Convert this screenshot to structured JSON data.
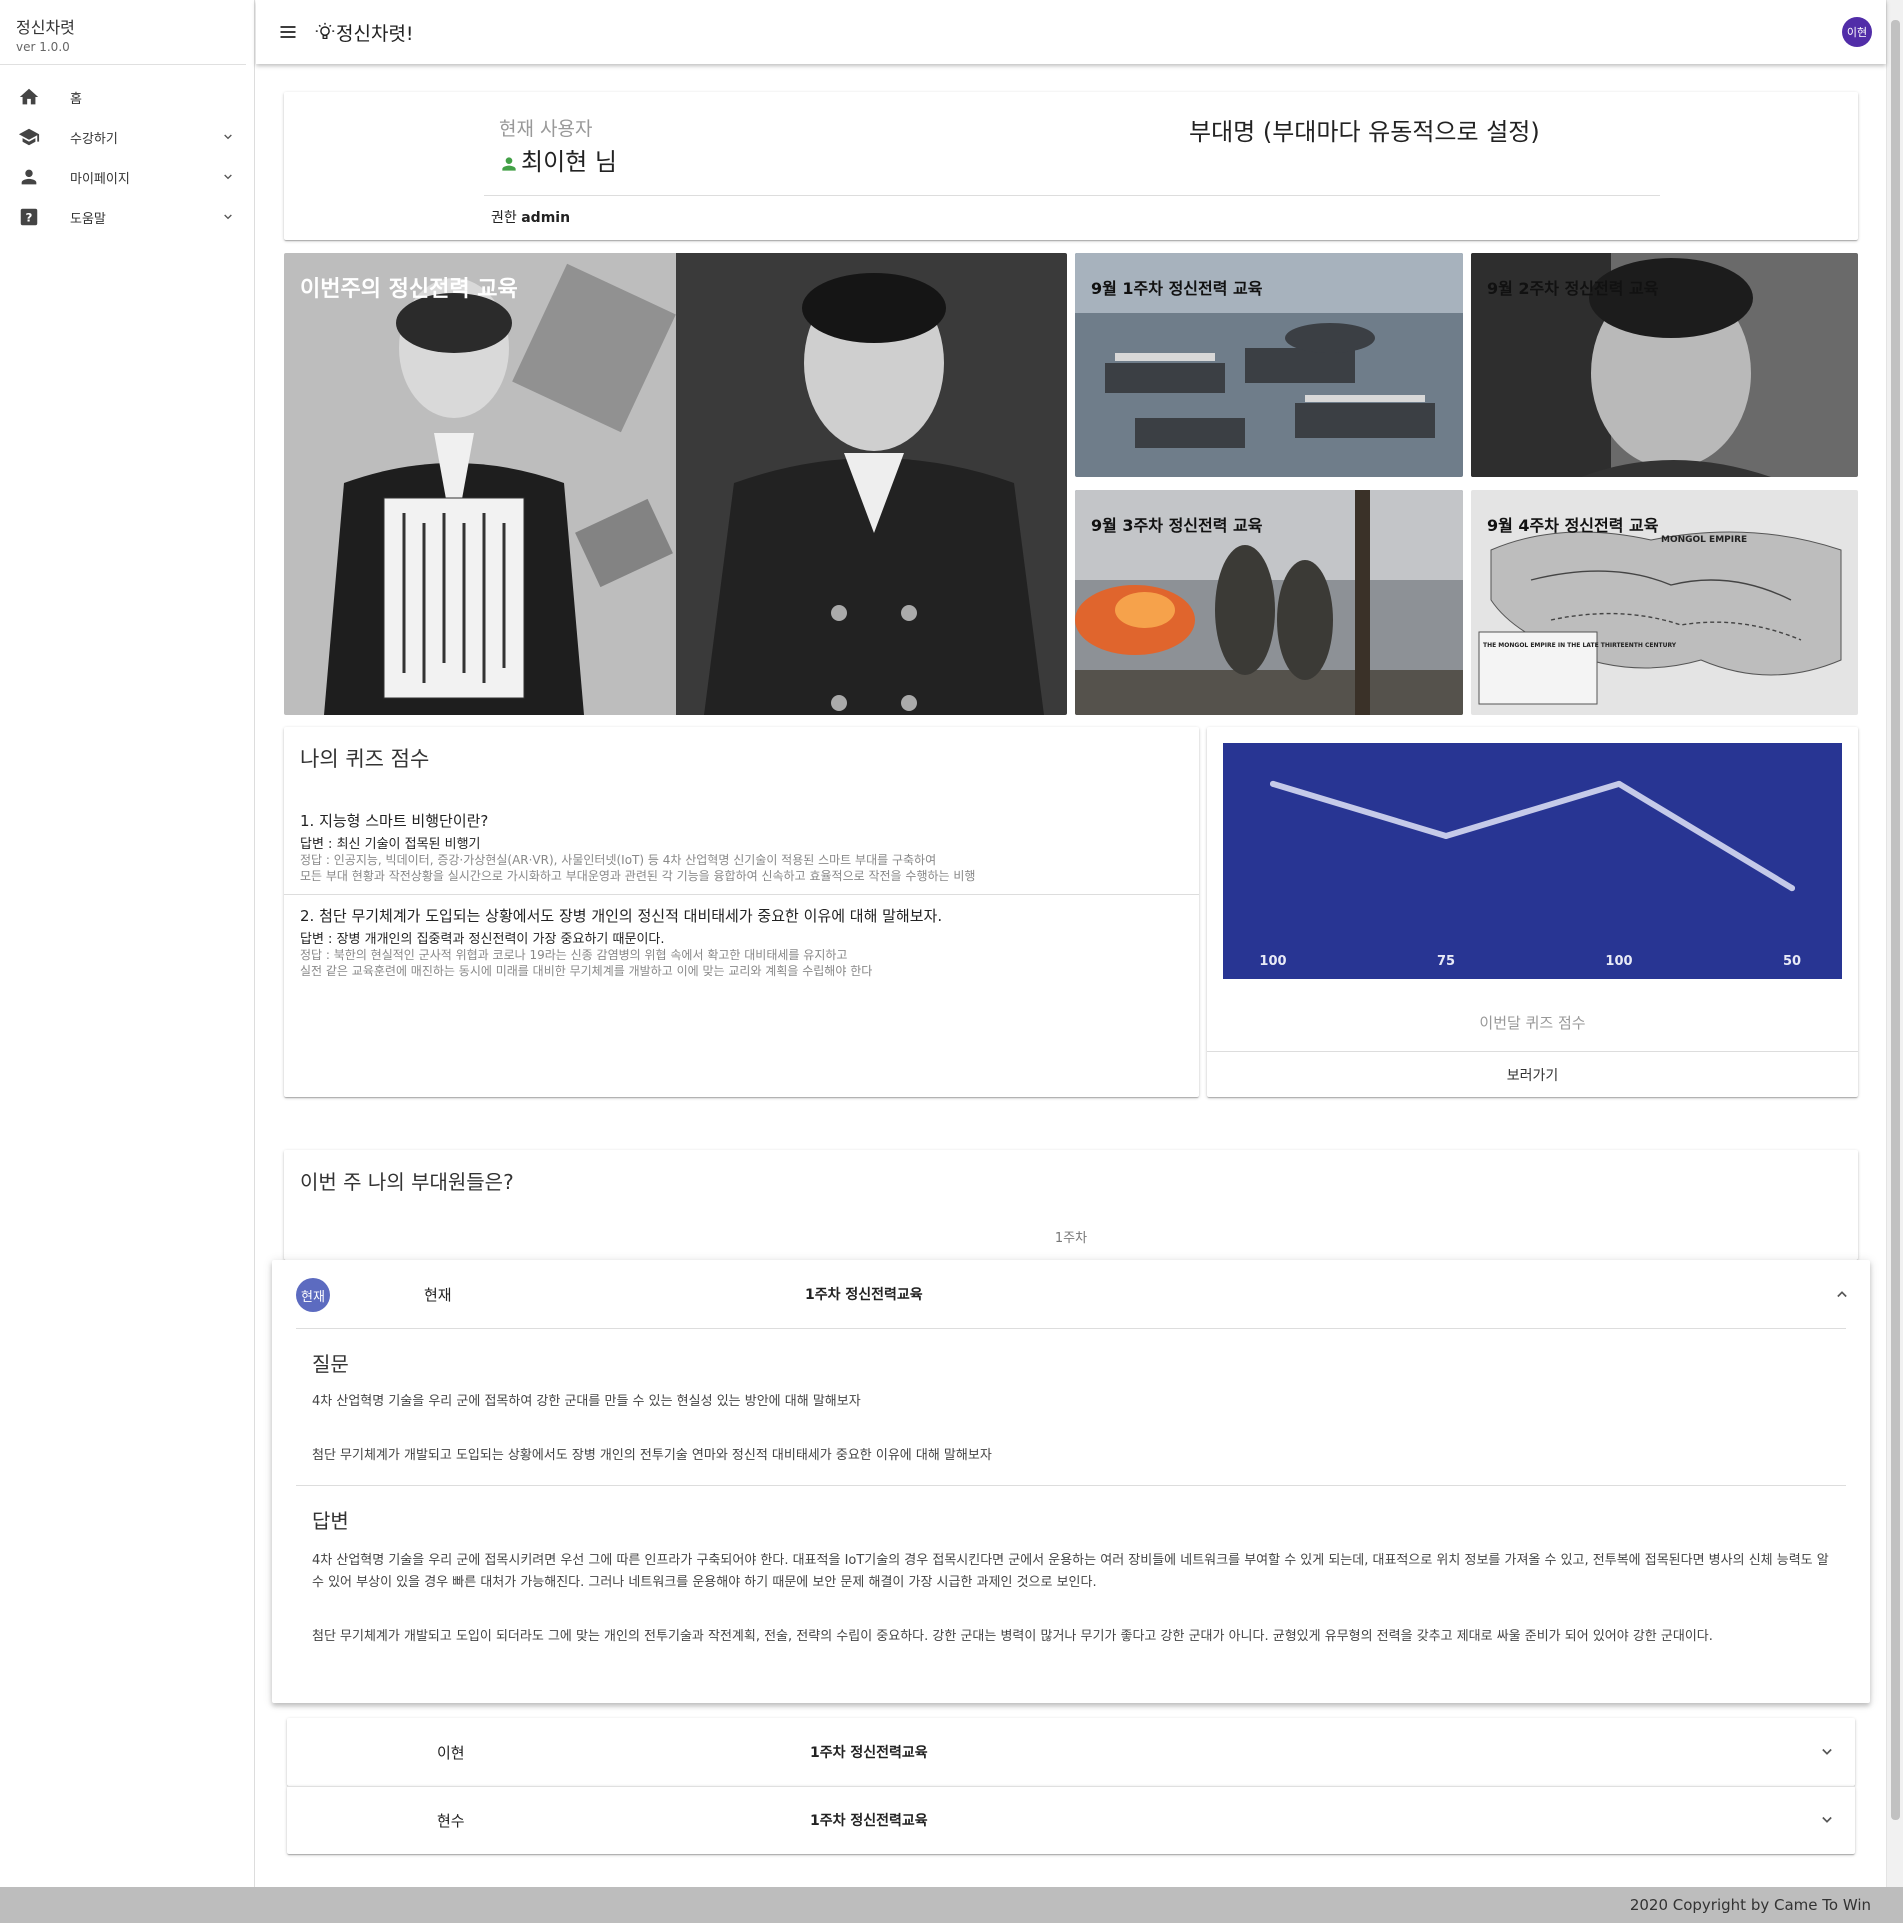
{
  "sidebar": {
    "title": "정신차렷",
    "version": "ver 1.0.0",
    "items": [
      {
        "label": "홈",
        "icon": "home-icon"
      },
      {
        "label": "수강하기",
        "icon": "school-icon"
      },
      {
        "label": "마이페이지",
        "icon": "person-icon"
      },
      {
        "label": "도움말",
        "icon": "help-icon"
      }
    ]
  },
  "header": {
    "title": "정신차렷!",
    "avatar": "이현"
  },
  "user_card": {
    "label": "현재 사용자",
    "name": "최이현 님",
    "unit": "부대명 (부대마다 유동적으로 설정)",
    "role_label": "권한",
    "role": "admin"
  },
  "tiles": {
    "main": "이번주의 정신전력 교육",
    "w1": "9월 1주차 정신전력 교육",
    "w2": "9월 2주차 정신전력 교육",
    "w3": "9월 3주차 정신전력 교육",
    "w4": "9월 4주차 정신전력 교육"
  },
  "map_labels": [
    "MONGOL EMPIRE",
    "THE MONGOL EMPIRE IN THE LATE THIRTEENTH CENTURY"
  ],
  "quiz": {
    "title": "나의 퀴즈 점수",
    "items": [
      {
        "question": "1. 지능형 스마트 비행단이란?",
        "answer": "답변 : 최신 기술이 접목된 비행기",
        "solution1": "정답 : 인공지능, 빅데이터, 증강·가상현실(AR·VR), 사물인터넷(IoT) 등 4차 산업혁명 신기술이 적용된 스마트 부대를 구축하여",
        "solution2": "모든 부대 현황과 작전상황을 실시간으로 가시화하고 부대운영과 관련된 각 기능을 융합하여 신속하고 효율적으로 작전을 수행하는 비행"
      },
      {
        "question": "2. 첨단 무기체계가 도입되는 상황에서도 장병 개인의 정신적 대비태세가 중요한 이유에 대해 말해보자.",
        "answer": "답변 : 장병 개개인의 집중력과 정신전력이 가장 중요하기 때문이다.",
        "solution1": "정답 : 북한의 현실적인 군사적 위협과 코로나 19라는 신종 감염병의 위협 속에서 확고한 대비태세를 유지하고",
        "solution2": "실전 같은 교육훈련에 매진하는 동시에 미래를 대비한 무기체계를 개발하고 이에 맞는 교리와 계획을 수립해야 한다"
      }
    ]
  },
  "chart_data": {
    "type": "line",
    "title": "",
    "xlabel": "",
    "ylabel": "",
    "values": [
      100,
      75,
      100,
      50
    ],
    "ylim": [
      40,
      110
    ],
    "grid": false,
    "line_color": "#c5cae9",
    "background": "#283593"
  },
  "chart_card": {
    "caption": "이번달 퀴즈 점수",
    "button": "보러가기"
  },
  "members": {
    "title": "이번 주 나의 부대원들은?",
    "week": "1주차",
    "open_panel": {
      "avatar": "현재",
      "name": "현재",
      "course": "1주차 정신전력교육",
      "question_heading": "질문",
      "questions": [
        "4차 산업혁명 기술을 우리 군에 접목하여 강한 군대를 만들 수 있는 현실성 있는 방안에 대해 말해보자",
        "첨단 무기체계가 개발되고 도입되는 상황에서도 장병 개인의 전투기술 연마와 정신적 대비태세가 중요한 이유에 대해 말해보자"
      ],
      "answer_heading": "답변",
      "answers": [
        "4차 산업혁명 기술을 우리 군에 접목시키려면 우선 그에 따른 인프라가 구축되어야 한다. 대표적을 IoT기술의 경우 접목시킨다면 군에서 운용하는 여러 장비들에 네트워크를 부여할 수 있게 되는데, 대표적으로 위치 정보를 가져올 수 있고, 전투복에 접목된다면 병사의 신체 능력도 알 수 있어 부상이 있을 경우 빠른 대처가 가능해진다. 그러나 네트워크를 운용해야 하기 때문에 보안 문제 해결이 가장 시급한 과제인 것으로 보인다.",
        "첨단 무기체계가 개발되고 도입이 되더라도 그에 맞는 개인의 전투기술과 작전계획, 전술, 전략의 수립이 중요하다. 강한 군대는 병력이 많거나 무기가 좋다고 강한 군대가 아니다. 균형있게 유무형의 전력을 갖추고 제대로 싸울 준비가 되어 있어야 강한 군대이다."
      ]
    },
    "closed_panels": [
      {
        "name": "이현",
        "course": "1주차 정신전력교육"
      },
      {
        "name": "현수",
        "course": "1주차 정신전력교육"
      }
    ]
  },
  "footer": "2020 Copyright by Came To Win"
}
